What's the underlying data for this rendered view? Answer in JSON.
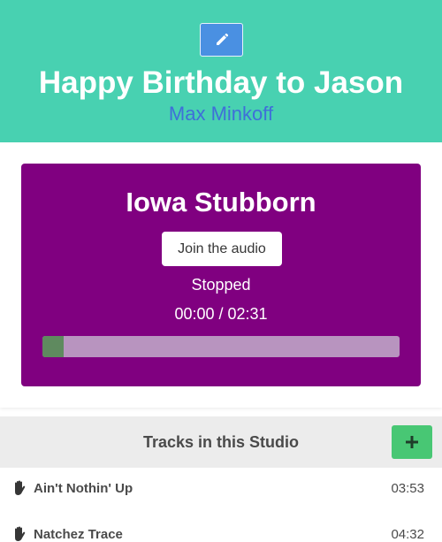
{
  "header": {
    "title": "Happy Birthday to Jason",
    "author": "Max Minkoff",
    "edit_icon": "pencil-icon",
    "background_color": "#48d1b1"
  },
  "player": {
    "song_title": "Iowa Stubborn",
    "join_label": "Join the audio",
    "status": "Stopped",
    "time": "00:00 / 02:31",
    "progress": 0.06,
    "background_color": "#800080"
  },
  "tracks": {
    "title": "Tracks in this Studio",
    "add_icon": "plus-icon",
    "items": [
      {
        "name": "Ain't Nothin' Up",
        "duration": "03:53",
        "icon": "hand-icon"
      },
      {
        "name": "Natchez Trace",
        "duration": "04:32",
        "icon": "hand-icon"
      }
    ]
  }
}
